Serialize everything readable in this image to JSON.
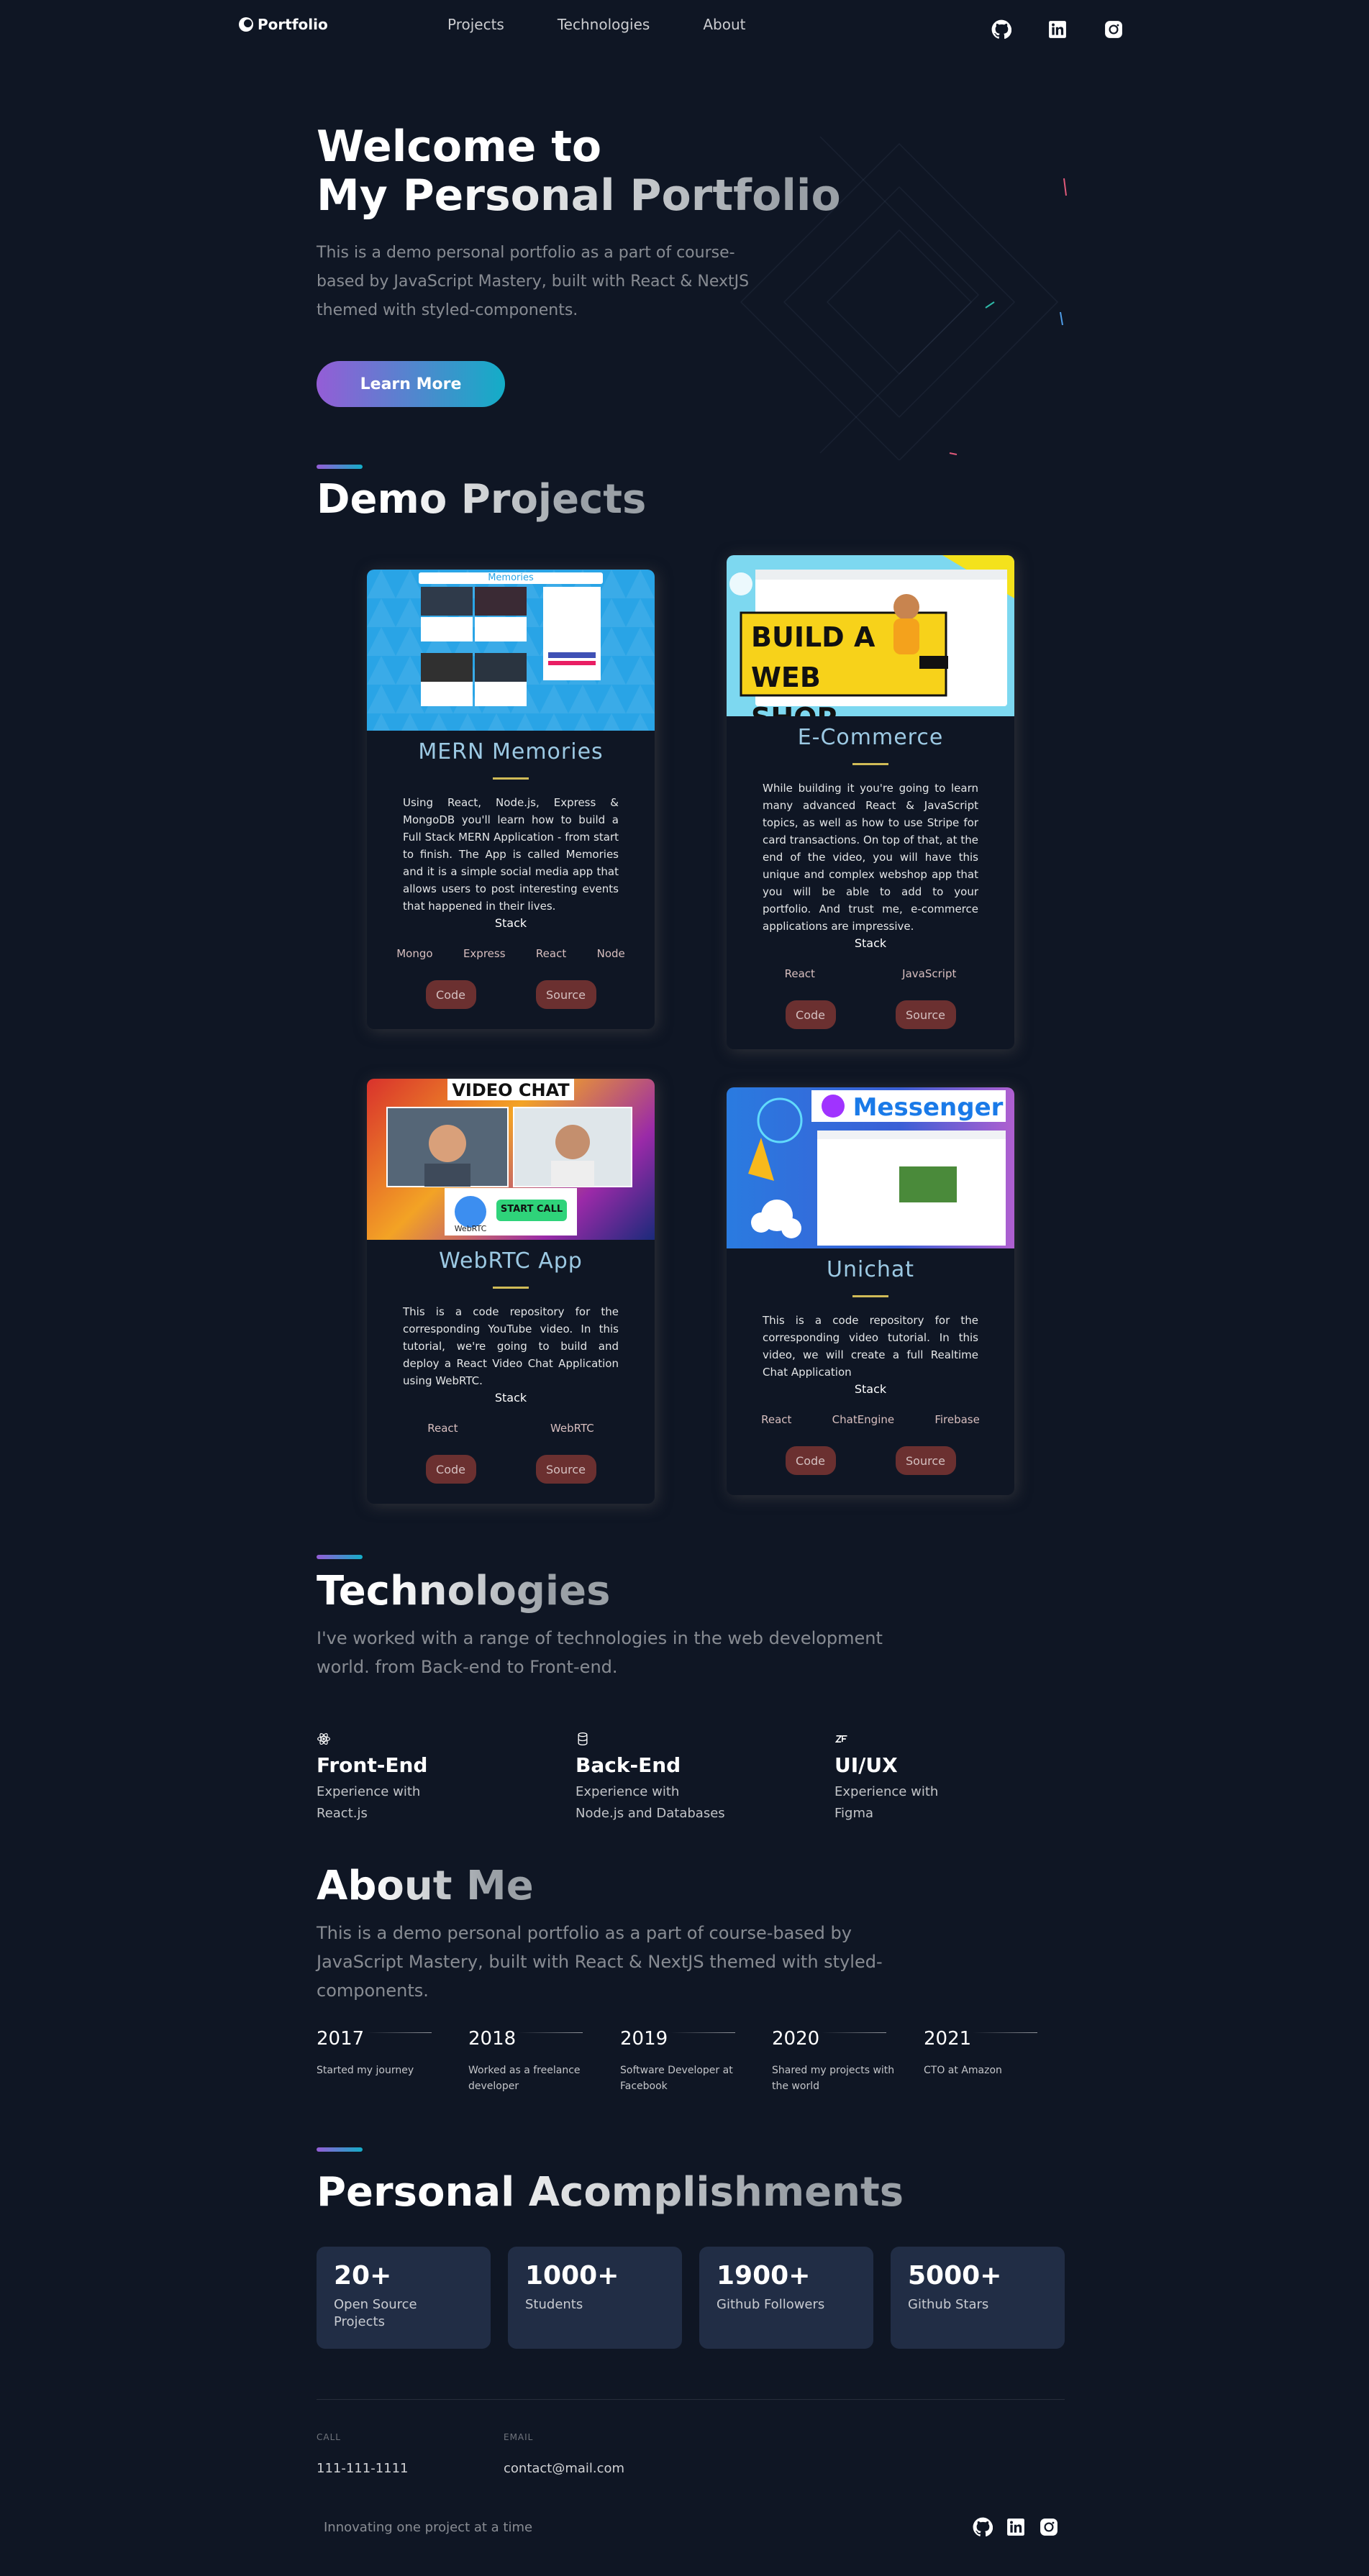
{
  "header": {
    "logo_text": "Portfolio",
    "nav": [
      "Projects",
      "Technologies",
      "About"
    ],
    "social": [
      "github-icon",
      "linkedin-icon",
      "instagram-icon"
    ]
  },
  "hero": {
    "title_line1": "Welcome to",
    "title_line2": "My Personal Portfolio",
    "description": "This is a demo personal portfolio as a part of course-based by JavaScript Mastery, built with React & NextJS themed with styled-components.",
    "button": "Learn More"
  },
  "projects": {
    "title": "Demo Projects",
    "stack_label": "Stack",
    "cards": [
      {
        "title": "MERN Memories",
        "image_title": "Memories",
        "description": "Using React, Node.js, Express & MongoDB you'll learn how to build a Full Stack MERN Application - from start to finish. The App is called Memories and it is a simple social media app that allows users to post interesting events that happened in their lives.",
        "tags": [
          "Mongo",
          "Express",
          "React",
          "Node"
        ],
        "code": "Code",
        "source": "Source"
      },
      {
        "title": "E-Commerce",
        "image_title": "BUILD A WEB SHOP",
        "description": "While building it you're going to learn many advanced React & JavaScript topics, as well as how to use Stripe for card transactions. On top of that, at the end of the video, you will have this unique and complex webshop app that you will be able to add to your portfolio. And trust me, e-commerce applications are impressive.",
        "tags": [
          "React",
          "JavaScript"
        ],
        "code": "Code",
        "source": "Source"
      },
      {
        "title": "WebRTC App",
        "image_title": "VIDEO CHAT",
        "image_button": "START CALL",
        "image_logo_text": "WebRTC",
        "description": "This is a code repository for the corresponding YouTube video. In this tutorial, we're going to build and deploy a React Video Chat Application using WebRTC.",
        "tags": [
          "React",
          "WebRTC"
        ],
        "code": "Code",
        "source": "Source"
      },
      {
        "title": "Unichat",
        "image_title": "Messenger",
        "description": "This is a code repository for the corresponding video tutorial. In this video, we will create a full Realtime Chat Application",
        "tags": [
          "React",
          "ChatEngine",
          "Firebase"
        ],
        "code": "Code",
        "source": "Source"
      }
    ]
  },
  "technologies": {
    "title": "Technologies",
    "description": "I've worked with a range of technologies in the web development world. from Back-end to Front-end.",
    "items": [
      {
        "title": "Front-End",
        "line1": "Experience with",
        "line2": "React.js",
        "icon": "react-icon"
      },
      {
        "title": "Back-End",
        "line1": "Experience with",
        "line2": "Node.js and Databases",
        "icon": "database-icon"
      },
      {
        "title": "UI/UX",
        "line1": "Experience with",
        "line2": "Figma",
        "icon": "zeplin-icon"
      }
    ]
  },
  "about": {
    "title": "About Me",
    "description": "This is a demo personal portfolio as a part of course-based by JavaScript Mastery, built with React & NextJS themed with styled-components.",
    "timeline": [
      {
        "year": "2017",
        "text": "Started my journey"
      },
      {
        "year": "2018",
        "text": "Worked as a freelance developer"
      },
      {
        "year": "2019",
        "text": "Software Developer at Facebook"
      },
      {
        "year": "2020",
        "text": "Shared my projects with the world"
      },
      {
        "year": "2021",
        "text": "CTO at Amazon"
      }
    ]
  },
  "accomplishments": {
    "title": "Personal Acomplishments",
    "items": [
      {
        "number": "20+",
        "label": "Open Source Projects"
      },
      {
        "number": "1000+",
        "label": "Students"
      },
      {
        "number": "1900+",
        "label": "Github Followers"
      },
      {
        "number": "5000+",
        "label": "Github Stars"
      }
    ]
  },
  "footer": {
    "call_label": "CALL",
    "call_value": "111-111-1111",
    "email_label": "EMAIL",
    "email_value": "contact@mail.com",
    "slogan": "Innovating one project at a time"
  },
  "colors": {
    "background": "#0f1624",
    "accent_start": "#945dd6",
    "accent_end": "#13adc7",
    "card_title": "#9cc9e3",
    "button_bg": "#6b3030",
    "box_bg": "#212d45"
  }
}
